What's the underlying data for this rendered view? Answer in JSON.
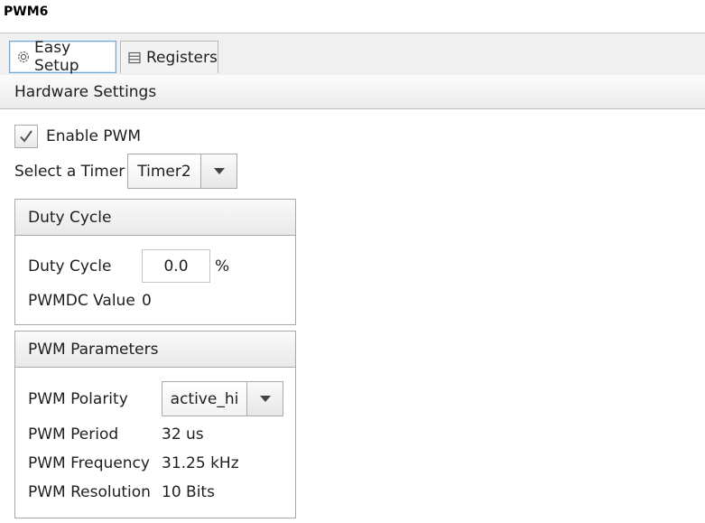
{
  "window": {
    "title": "PWM6"
  },
  "tabs": [
    {
      "label": "Easy Setup",
      "icon": "gear-icon",
      "active": true
    },
    {
      "label": "Registers",
      "icon": "list-icon",
      "active": false
    }
  ],
  "hardware_settings": {
    "header": "Hardware Settings",
    "enable_pwm": {
      "label": "Enable PWM",
      "checked": true
    },
    "timer": {
      "label": "Select a Timer :",
      "value": "Timer2"
    }
  },
  "duty_cycle_panel": {
    "header": "Duty Cycle",
    "duty_cycle_label": "Duty Cycle",
    "duty_cycle_value": "0.0",
    "duty_cycle_unit": "%",
    "pwmdc_label": "PWMDC Value",
    "pwmdc_value": "0"
  },
  "pwm_parameters_panel": {
    "header": "PWM Parameters",
    "polarity_label": "PWM Polarity",
    "polarity_value": "active_hi",
    "period_label": "PWM Period",
    "period_value": "32 us",
    "frequency_label": "PWM Frequency",
    "frequency_value": "31.25 kHz",
    "resolution_label": "PWM Resolution",
    "resolution_value": "10 Bits"
  },
  "colors": {
    "accent_tab_border": "#6ea7d8",
    "panel_border": "#a8a8a8"
  }
}
